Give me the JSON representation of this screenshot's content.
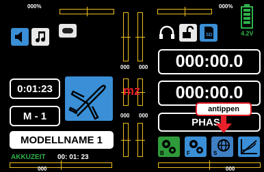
{
  "trims": {
    "top_left_pct": "000%",
    "top_right_pct": "000%",
    "left_vert_left_value": "000",
    "left_vert_right_value": "000",
    "right_vert_left_value": "000",
    "right_vert_right_value": "000",
    "mid_left_vert_left_value": "000",
    "mid_left_vert_right_value": "000",
    "mid_right_vert_left_value": "000",
    "mid_right_vert_right_value": "000",
    "bottom_left_value": "000",
    "bottom_right_value": "000"
  },
  "battery": {
    "voltage": "4.2V"
  },
  "timers": {
    "top_timer": "000:00.0",
    "mid_timer": "000:00.0",
    "model_time": "0:01:23"
  },
  "model": {
    "number": "M - 1",
    "name": "MODELLNAME  1",
    "type_label": "mz"
  },
  "phase": {
    "label": "PHASE"
  },
  "callout": {
    "label": "antippen"
  },
  "akku": {
    "label": "AKKUZEIT",
    "value": "00: 01: 23"
  },
  "colors": {
    "accent_yellow": "#f0c020",
    "button_blue": "#3a8fd6",
    "green": "#2f9a3a",
    "red": "#e8202a"
  }
}
